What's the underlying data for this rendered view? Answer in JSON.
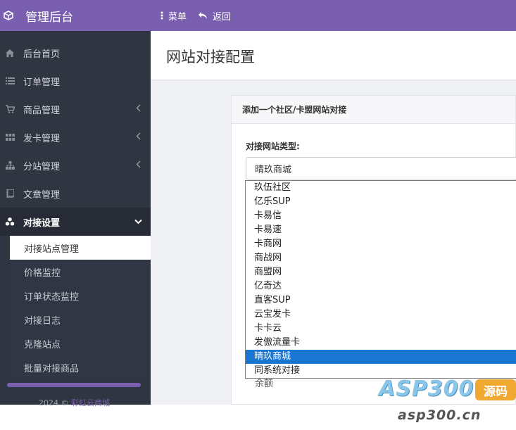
{
  "header": {
    "brand": "管理后台",
    "menu_label": "菜单",
    "back_label": "返回"
  },
  "sidebar": {
    "items": [
      {
        "label": "后台首页",
        "icon": "home-icon"
      },
      {
        "label": "订单管理",
        "icon": "list-icon"
      },
      {
        "label": "商品管理",
        "icon": "cart-icon"
      },
      {
        "label": "发卡管理",
        "icon": "grid-icon"
      },
      {
        "label": "分站管理",
        "icon": "sitemap-icon"
      },
      {
        "label": "文章管理",
        "icon": "book-icon"
      },
      {
        "label": "对接设置",
        "icon": "cubes-icon"
      }
    ],
    "sub_items": [
      "对接站点管理",
      "价格监控",
      "订单状态监控",
      "对接日志",
      "克隆站点",
      "批量对接商品"
    ],
    "footer_prefix": "2024 ©",
    "footer_link": "彩虹云商城"
  },
  "main": {
    "page_title": "网站对接配置",
    "panel_title": "添加一个社区/卡盟网站对接",
    "field_label": "对接网站类型:",
    "selected_value": "晴玖商城",
    "partial_text_below": "余额"
  },
  "dropdown": {
    "options": [
      "玖伍社区",
      "亿乐SUP",
      "卡易信",
      "卡易速",
      "卡商网",
      "商战网",
      "商盟网",
      "亿奇达",
      "直客SUP",
      "云宝发卡",
      "卡卡云",
      "发傲流量卡",
      "晴玖商城",
      "同系统对接"
    ],
    "selected_index": 12
  },
  "watermark": {
    "big": "ASP300",
    "tag": "源码",
    "small": "asp300.cn"
  },
  "colors": {
    "accent": "#7a5fb0",
    "sidebar_bg": "#2f3541",
    "selected_option": "#1976d2"
  }
}
